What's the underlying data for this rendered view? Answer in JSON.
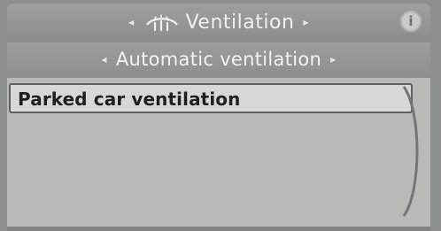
{
  "header": {
    "title": "Ventilation",
    "left_arrow": "◂",
    "right_arrow": "▸",
    "info_label": "i",
    "icon_name": "ventilation-icon"
  },
  "subheader": {
    "title": "Automatic ventilation",
    "left_arrow": "◂",
    "right_arrow": "▸"
  },
  "list": {
    "items": [
      {
        "label": "Parked car ventilation"
      }
    ]
  },
  "colors": {
    "background": "#8b8f8d",
    "list_background": "#b8bbb5",
    "selected_background": "#d6d8d4",
    "selected_border": "#5d615f",
    "text_light": "#eef0ee",
    "text_dark": "#1e2120"
  }
}
